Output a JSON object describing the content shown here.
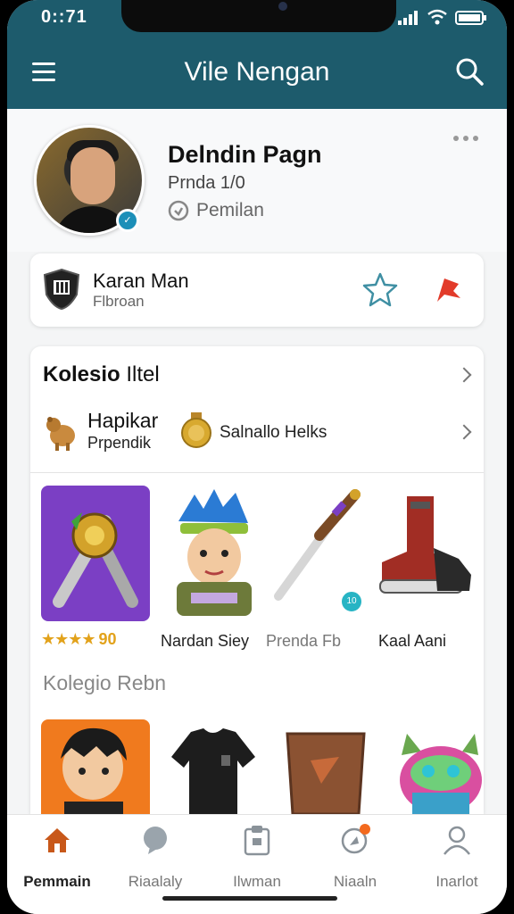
{
  "status": {
    "time": "0::71"
  },
  "app": {
    "title": "Vile Nengan"
  },
  "profile": {
    "name": "Delndin Pagn",
    "level": "Prnda 1/0",
    "role": "Pemilan"
  },
  "team": {
    "name": "Karan Man",
    "subtitle": "Flbroan"
  },
  "collection": {
    "title_bold": "Kolesio",
    "title_rest": " Iltel",
    "sub_item": {
      "title": "Hapikar",
      "subtitle": "Prpendik"
    },
    "medal_text": "Salnallo Helks",
    "items": [
      {
        "label": "",
        "rating_text": "90",
        "stars": 4
      },
      {
        "label": "Nardan Siey"
      },
      {
        "label": "Prenda Fb"
      },
      {
        "label": "Kaal Aani"
      }
    ],
    "section2_title": "Kolegio Rebn"
  },
  "nav": [
    {
      "label": "Pemmain",
      "icon": "home-icon",
      "active": true
    },
    {
      "label": "Riaalaly",
      "icon": "chat-icon",
      "active": false
    },
    {
      "label": "Ilwman",
      "icon": "clipboard-icon",
      "active": false
    },
    {
      "label": "Niaaln",
      "icon": "compass-icon",
      "active": false
    },
    {
      "label": "Inarlot",
      "icon": "profile-icon",
      "active": false
    }
  ],
  "colors": {
    "header": "#1d5b6c",
    "accent": "#c8581a",
    "star": "#e2a21b"
  }
}
